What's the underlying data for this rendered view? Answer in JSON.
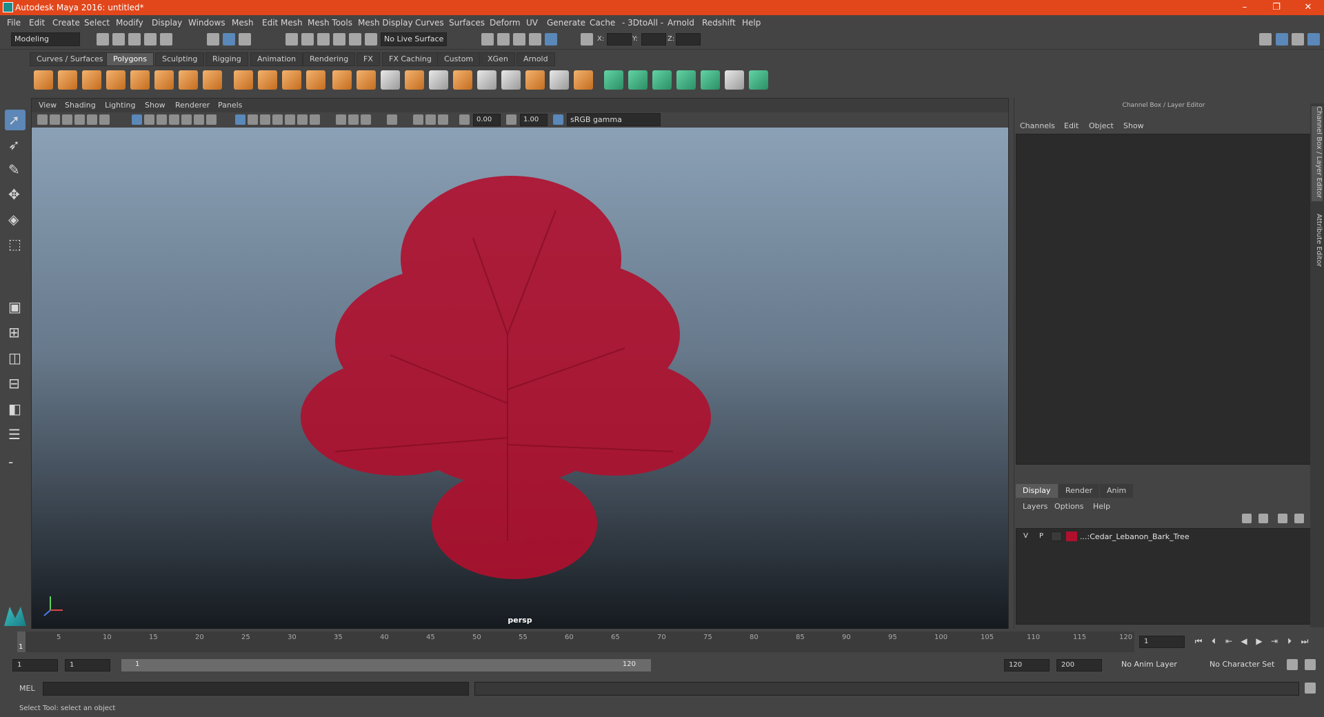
{
  "window": {
    "title": "Autodesk Maya 2016: untitled*",
    "minimize": "–",
    "maximize": "❐",
    "close": "✕"
  },
  "menubar": [
    "File",
    "Edit",
    "Create",
    "Select",
    "Modify",
    "Display",
    "Windows",
    "Mesh",
    "Edit Mesh",
    "Mesh Tools",
    "Mesh Display",
    "Curves",
    "Surfaces",
    "Deform",
    "UV",
    "Generate",
    "Cache",
    "- 3DtoAll -",
    "Arnold",
    "Redshift",
    "Help"
  ],
  "statusline": {
    "mode": "Modeling",
    "live_surface": "No Live Surface",
    "x_label": "X:",
    "y_label": "Y:",
    "z_label": "Z:"
  },
  "shelf_tabs": [
    {
      "label": "Curves / Surfaces",
      "active": false
    },
    {
      "label": "Polygons",
      "active": true
    },
    {
      "label": "Sculpting",
      "active": false
    },
    {
      "label": "Rigging",
      "active": false
    },
    {
      "label": "Animation",
      "active": false
    },
    {
      "label": "Rendering",
      "active": false
    },
    {
      "label": "FX",
      "active": false
    },
    {
      "label": "FX Caching",
      "active": false
    },
    {
      "label": "Custom",
      "active": false
    },
    {
      "label": "XGen",
      "active": false
    },
    {
      "label": "Arnold",
      "active": false
    }
  ],
  "panel": {
    "menu": [
      "View",
      "Shading",
      "Lighting",
      "Show",
      "Renderer",
      "Panels"
    ],
    "exposure": "0.00",
    "gamma": "1.00",
    "color_space": "sRGB gamma",
    "camera_label": "persp"
  },
  "channel_box": {
    "title": "Channel Box / Layer Editor",
    "menu": [
      "Channels",
      "Edit",
      "Object",
      "Show"
    ]
  },
  "layer_editor": {
    "tabs": [
      {
        "label": "Display",
        "active": true
      },
      {
        "label": "Render",
        "active": false
      },
      {
        "label": "Anim",
        "active": false
      }
    ],
    "menu": [
      "Layers",
      "Options",
      "Help"
    ],
    "layers": [
      {
        "v": "V",
        "p": "P",
        "name": "...:Cedar_Lebanon_Bark_Tree",
        "color": "#b0102e"
      }
    ]
  },
  "side_tabs": [
    "Channel Box / Layer Editor",
    "Attribute Editor"
  ],
  "colors": {
    "accent": "#5a88b8",
    "titlebar": "#e2461b",
    "tree": "#b0102e"
  },
  "timeslider": {
    "ticks": [
      "5",
      "10",
      "15",
      "20",
      "25",
      "30",
      "35",
      "40",
      "45",
      "50",
      "55",
      "60",
      "65",
      "70",
      "75",
      "80",
      "85",
      "90",
      "95",
      "100",
      "105",
      "110",
      "115",
      "120"
    ],
    "current_frame_marker": "1",
    "current_frame_field": "1"
  },
  "range": {
    "start": "1",
    "playback_start": "1",
    "slider_start": "1",
    "slider_end": "120",
    "playback_end": "120",
    "end": "200",
    "anim_layer": "No Anim Layer",
    "character_set": "No Character Set"
  },
  "cmdline": {
    "label": "MEL"
  },
  "helpline": {
    "text": "Select Tool: select an object"
  }
}
